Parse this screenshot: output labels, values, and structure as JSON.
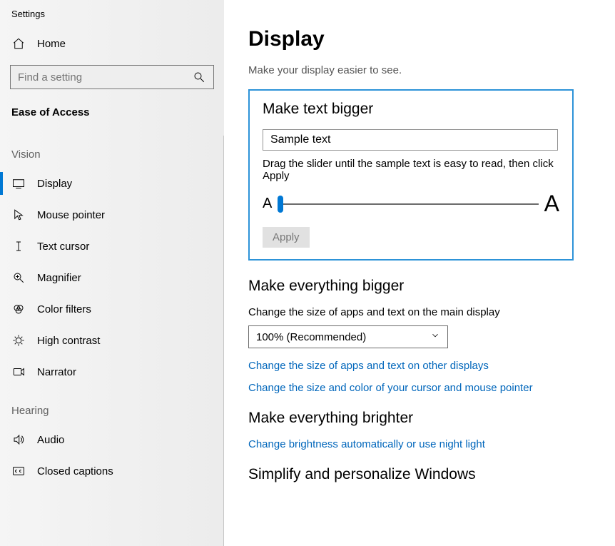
{
  "app_title": "Settings",
  "home_label": "Home",
  "search_placeholder": "Find a setting",
  "current_category": "Ease of Access",
  "groups": {
    "vision": {
      "header": "Vision",
      "items": [
        "Display",
        "Mouse pointer",
        "Text cursor",
        "Magnifier",
        "Color filters",
        "High contrast",
        "Narrator"
      ]
    },
    "hearing": {
      "header": "Hearing",
      "items": [
        "Audio",
        "Closed captions"
      ]
    }
  },
  "page": {
    "title": "Display",
    "subtitle": "Make your display easier to see."
  },
  "make_text_bigger": {
    "heading": "Make text bigger",
    "sample": "Sample text",
    "instruction": "Drag the slider until the sample text is easy to read, then click Apply",
    "small_glyph": "A",
    "big_glyph": "A",
    "apply_label": "Apply"
  },
  "make_everything_bigger": {
    "heading": "Make everything bigger",
    "desc": "Change the size of apps and text on the main display",
    "selected": "100% (Recommended)",
    "link1": "Change the size of apps and text on other displays",
    "link2": "Change the size and color of your cursor and mouse pointer"
  },
  "make_brighter": {
    "heading": "Make everything brighter",
    "link": "Change brightness automatically or use night light"
  },
  "simplify": {
    "heading": "Simplify and personalize Windows"
  }
}
